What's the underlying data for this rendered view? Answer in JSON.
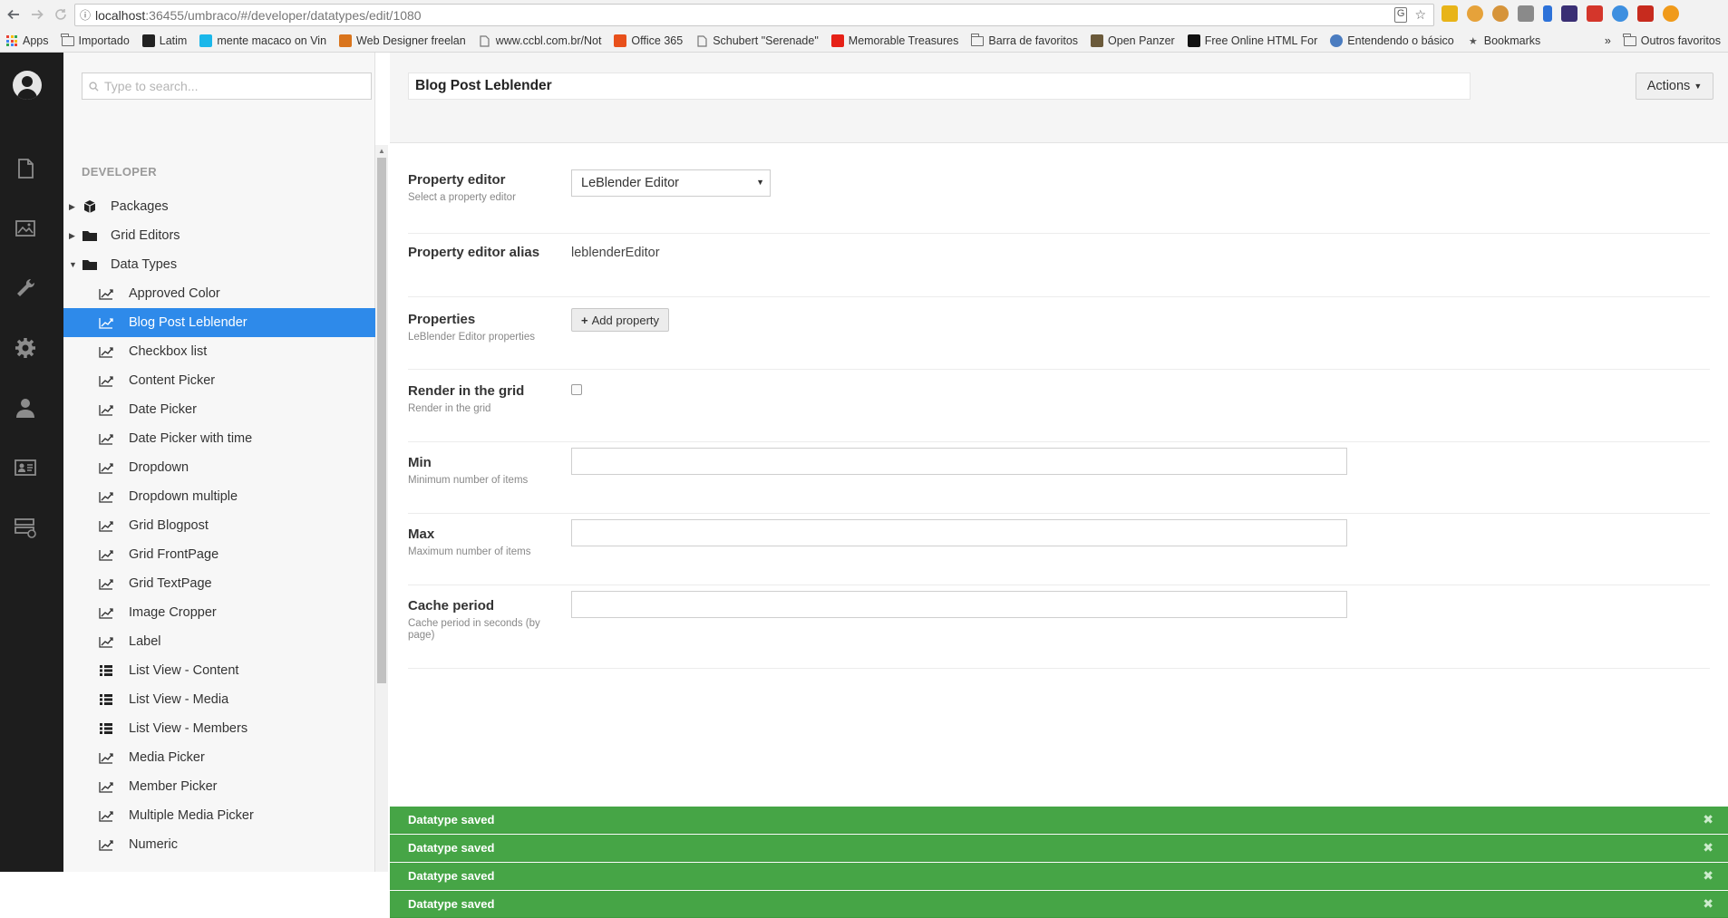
{
  "browser": {
    "url_host": "localhost",
    "url_rest": ":36455/umbraco/#/developer/datatypes/edit/1080",
    "bookmarks": [
      {
        "label": "Apps",
        "icon": "apps-grid-icon"
      },
      {
        "label": "Importado",
        "icon": "folder-icon"
      },
      {
        "label": "Latim",
        "icon": "lb-logo-icon"
      },
      {
        "label": "mente macaco on Vin",
        "icon": "vimeo-icon"
      },
      {
        "label": "Web Designer freelan",
        "icon": "t-logo-icon"
      },
      {
        "label": "www.ccbl.com.br/Not",
        "icon": "page-icon"
      },
      {
        "label": "Office 365",
        "icon": "office-icon"
      },
      {
        "label": "Schubert \"Serenade\"",
        "icon": "page-icon"
      },
      {
        "label": "Memorable Treasures",
        "icon": "youtube-icon"
      },
      {
        "label": "Barra de favoritos",
        "icon": "folder-icon"
      },
      {
        "label": "Open Panzer",
        "icon": "tank-icon"
      },
      {
        "label": "Free Online HTML For",
        "icon": "ff-logo-icon"
      },
      {
        "label": "Entendendo o básico",
        "icon": "globe-icon"
      },
      {
        "label": "Bookmarks",
        "icon": "star-icon"
      }
    ],
    "overflow": "»",
    "other_bookmarks": "Outros favoritos"
  },
  "search": {
    "placeholder": "Type to search..."
  },
  "tree": {
    "heading": "DEVELOPER",
    "nodes": [
      {
        "label": "Packages",
        "level": 1,
        "icon": "package-icon",
        "caret": "▶"
      },
      {
        "label": "Grid Editors",
        "level": 1,
        "icon": "folder-icon",
        "caret": "▶"
      },
      {
        "label": "Data Types",
        "level": 1,
        "icon": "folder-icon",
        "caret": "▼"
      },
      {
        "label": "Approved Color",
        "level": 2,
        "icon": "datatype-icon"
      },
      {
        "label": "Blog Post Leblender",
        "level": 2,
        "icon": "datatype-icon",
        "selected": true
      },
      {
        "label": "Checkbox list",
        "level": 2,
        "icon": "datatype-icon"
      },
      {
        "label": "Content Picker",
        "level": 2,
        "icon": "datatype-icon"
      },
      {
        "label": "Date Picker",
        "level": 2,
        "icon": "datatype-icon"
      },
      {
        "label": "Date Picker with time",
        "level": 2,
        "icon": "datatype-icon"
      },
      {
        "label": "Dropdown",
        "level": 2,
        "icon": "datatype-icon"
      },
      {
        "label": "Dropdown multiple",
        "level": 2,
        "icon": "datatype-icon"
      },
      {
        "label": "Grid Blogpost",
        "level": 2,
        "icon": "datatype-icon"
      },
      {
        "label": "Grid FrontPage",
        "level": 2,
        "icon": "datatype-icon"
      },
      {
        "label": "Grid TextPage",
        "level": 2,
        "icon": "datatype-icon"
      },
      {
        "label": "Image Cropper",
        "level": 2,
        "icon": "datatype-icon"
      },
      {
        "label": "Label",
        "level": 2,
        "icon": "datatype-icon"
      },
      {
        "label": "List View - Content",
        "level": 2,
        "icon": "list-icon"
      },
      {
        "label": "List View - Media",
        "level": 2,
        "icon": "list-icon"
      },
      {
        "label": "List View - Members",
        "level": 2,
        "icon": "list-icon"
      },
      {
        "label": "Media Picker",
        "level": 2,
        "icon": "datatype-icon"
      },
      {
        "label": "Member Picker",
        "level": 2,
        "icon": "datatype-icon"
      },
      {
        "label": "Multiple Media Picker",
        "level": 2,
        "icon": "datatype-icon"
      },
      {
        "label": "Numeric",
        "level": 2,
        "icon": "datatype-icon"
      }
    ]
  },
  "editor": {
    "name": "Blog Post Leblender",
    "actions_label": "Actions",
    "property_editor": {
      "label": "Property editor",
      "desc": "Select a property editor",
      "value": "LeBlender Editor"
    },
    "alias": {
      "label": "Property editor alias",
      "value": "leblenderEditor"
    },
    "properties": {
      "label": "Properties",
      "desc": "LeBlender Editor properties",
      "button": "Add property"
    },
    "render_grid": {
      "label": "Render in the grid",
      "desc": "Render in the grid"
    },
    "min": {
      "label": "Min",
      "desc": "Minimum number of items",
      "value": ""
    },
    "max": {
      "label": "Max",
      "desc": "Maximum number of items",
      "value": ""
    },
    "cache": {
      "label": "Cache period",
      "desc": "Cache period in seconds (by page)",
      "value": ""
    }
  },
  "notifications": [
    "Datatype saved",
    "Datatype saved",
    "Datatype saved",
    "Datatype saved"
  ],
  "colors": {
    "selected": "#2e8aea",
    "success": "#46a546",
    "sidebar": "#1d1d1d"
  }
}
